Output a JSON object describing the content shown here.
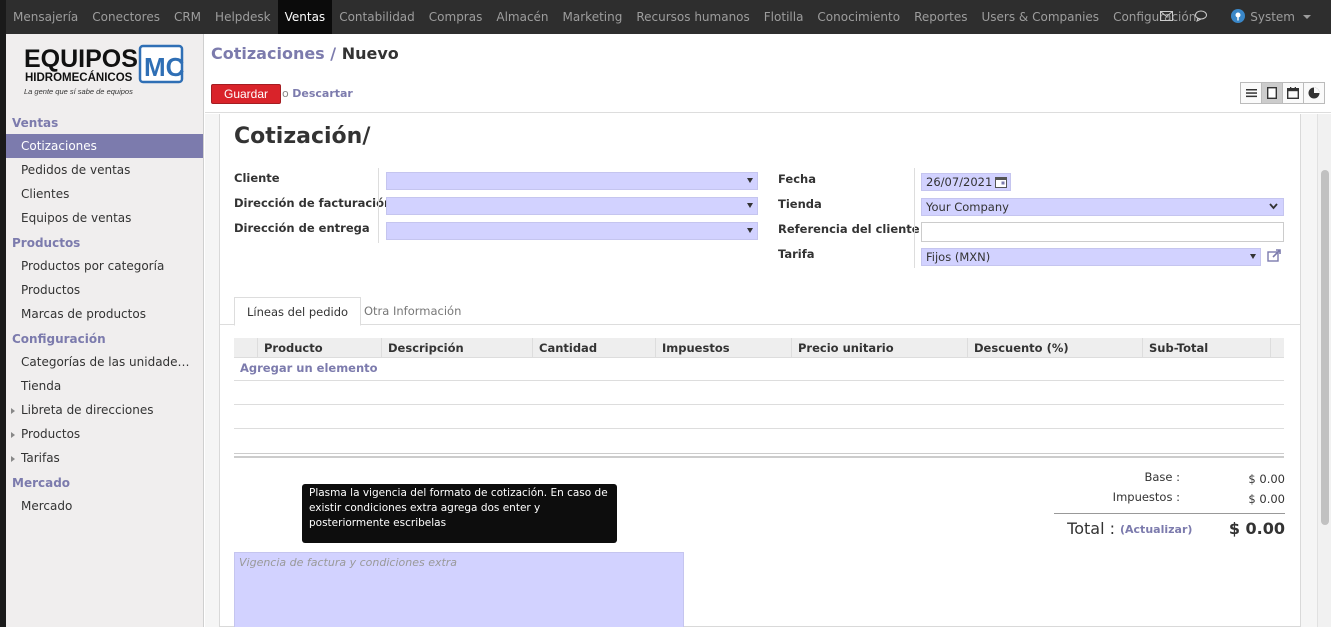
{
  "topbar": {
    "menu": [
      "Mensajería",
      "Conectores",
      "CRM",
      "Helpdesk",
      "Ventas",
      "Contabilidad",
      "Compras",
      "Almacén",
      "Marketing",
      "Recursos humanos",
      "Flotilla",
      "Conocimiento",
      "Reportes",
      "Users & Companies",
      "Configuración"
    ],
    "active": "Ventas",
    "user": "System"
  },
  "logo": {
    "line1": "EQUIPOS",
    "line2": "HIDROMECÁNICOS",
    "tagline": "La gente que sí sabe de equipos",
    "mark": "MC"
  },
  "sidebar": {
    "sections": [
      {
        "title": "Ventas",
        "items": [
          "Cotizaciones",
          "Pedidos de ventas",
          "Clientes",
          "Equipos de ventas"
        ]
      },
      {
        "title": "Productos",
        "items": [
          "Productos por categoría",
          "Productos",
          "Marcas de productos"
        ]
      },
      {
        "title": "Configuración",
        "items": [
          "Categorías de las unidade…",
          "Tienda",
          "Libreta de direcciones",
          "Productos",
          "Tarifas"
        ]
      },
      {
        "title": "Mercado",
        "items": [
          "Mercado"
        ]
      }
    ]
  },
  "breadcrumb": {
    "parent": "Cotizaciones",
    "sep": "/",
    "current": "Nuevo"
  },
  "actions": {
    "save": "Guardar",
    "or": "o",
    "discard": "Descartar"
  },
  "form": {
    "title": "Cotización/",
    "left_labels": [
      "Cliente",
      "Dirección de facturación",
      "Dirección de entrega"
    ],
    "right_labels": [
      "Fecha",
      "Tienda",
      "Referencia del cliente",
      "Tarifa"
    ],
    "fecha": "26/07/2021",
    "tienda": "Your Company",
    "tarifa": "Fijos (MXN)"
  },
  "tabs": [
    "Líneas del pedido",
    "Otra Información"
  ],
  "table": {
    "columns": [
      "Producto",
      "Descripción",
      "Cantidad",
      "Impuestos",
      "Precio unitario",
      "Descuento (%)",
      "Sub-Total"
    ],
    "add": "Agregar un elemento"
  },
  "totals": {
    "base_label": "Base :",
    "base": "$ 0.00",
    "tax_label": "Impuestos :",
    "tax": "$ 0.00",
    "total_label": "Total :",
    "update": "(Actualizar)",
    "total": "$ 0.00"
  },
  "tooltip": "Plasma la vigencia del formato de cotización. En caso de existir condiciones extra agrega dos enter y posteriormente escribelas",
  "notes": {
    "placeholder": "Vigencia de factura y condiciones extra"
  },
  "colors": {
    "accent": "#7c7bad",
    "save": "#d9232a",
    "field": "#d2d2ff"
  }
}
